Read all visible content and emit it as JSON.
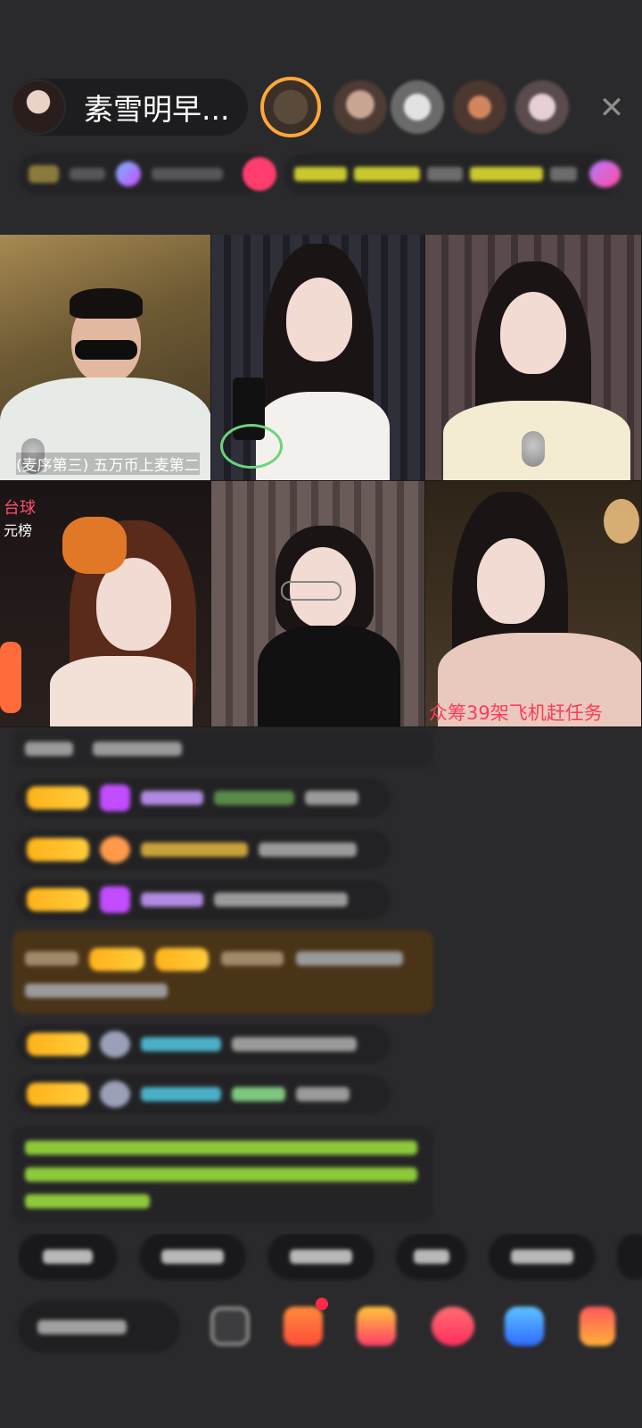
{
  "header": {
    "host_name": "素雪明早...",
    "close_icon": "close-icon"
  },
  "grid": {
    "tiles": [
      {
        "caption": "(麦序第三) 五万币上麦第二"
      },
      {
        "caption": ""
      },
      {
        "caption": ""
      },
      {
        "caption": "台球",
        "caption2": "元榜"
      },
      {
        "caption": ""
      },
      {
        "caption": "众筹39架飞机赶任务"
      }
    ]
  },
  "colors": {
    "badge": "#ffb21a",
    "accent_red": "#ff3b5c",
    "chat_green": "#8ec93a"
  }
}
